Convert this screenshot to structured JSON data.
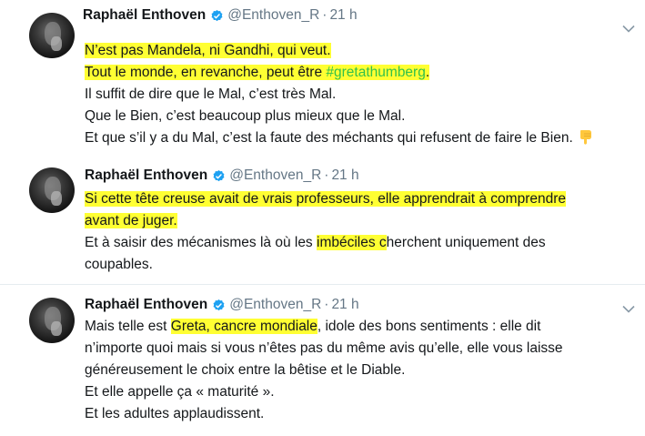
{
  "tweets": [
    {
      "name": "Raphaël Enthoven",
      "handle": "@Enthoven_R",
      "dot": "·",
      "time": "21 h",
      "lines": [
        [
          {
            "t": "N’est pas Mandela, ni Gandhi, qui veut.",
            "hl": true
          }
        ],
        [
          {
            "t": "Tout le monde, en revanche, peut être ",
            "hl": true
          },
          {
            "t": "#gretathumberg",
            "hl": true,
            "tag": true
          },
          {
            "t": ".",
            "hl": true
          }
        ],
        [
          {
            "t": "Il suffit de dire que le Mal, c’est très Mal."
          }
        ],
        [
          {
            "t": "Que le Bien, c’est beaucoup plus mieux que le Mal."
          }
        ],
        [
          {
            "t": "Et que s’il y a du Mal, c’est la faute des méchants qui refusent de faire le Bien."
          }
        ]
      ],
      "emoji": "pointing-down-hand-emoji",
      "menu": true
    },
    {
      "name": "Raphaël Enthoven",
      "handle": "@Enthoven_R",
      "dot": "·",
      "time": "21 h",
      "lines": [
        [
          {
            "t": "Si cette tête creuse avait de vrais professeurs, elle apprendrait à comprendre",
            "hl": true
          }
        ],
        [
          {
            "t": "avant de juger.",
            "hl": true
          }
        ],
        [
          {
            "t": "Et à saisir des mécanismes là où les "
          },
          {
            "t": "imbéciles c",
            "hl": true
          },
          {
            "t": "herchent uniquement des"
          }
        ],
        [
          {
            "t": "coupables."
          }
        ]
      ],
      "menu": false
    },
    {
      "name": "Raphaël Enthoven",
      "handle": "@Enthoven_R",
      "dot": "·",
      "time": "21 h",
      "lines": [
        [
          {
            "t": "Mais telle est "
          },
          {
            "t": "Greta, cancre mondiale",
            "hl": true
          },
          {
            "t": ", idole des bons sentiments : elle dit"
          }
        ],
        [
          {
            "t": "n’importe quoi mais si vous n’êtes pas du même avis qu’elle, elle vous laisse"
          }
        ],
        [
          {
            "t": "généreusement le choix entre la bêtise et le Diable."
          }
        ],
        [
          {
            "t": "Et elle appelle ça « maturité »."
          }
        ],
        [
          {
            "t": "Et les adultes applaudissent."
          }
        ]
      ],
      "menu": true
    }
  ],
  "colors": {
    "highlight": "#ffff33",
    "hashtag": "#33c14a",
    "verified": "#1da1f2",
    "muted": "#657786"
  },
  "icons": {
    "verified": "verified-badge-icon",
    "menu": "chevron-down-icon",
    "avatar": "avatar"
  }
}
